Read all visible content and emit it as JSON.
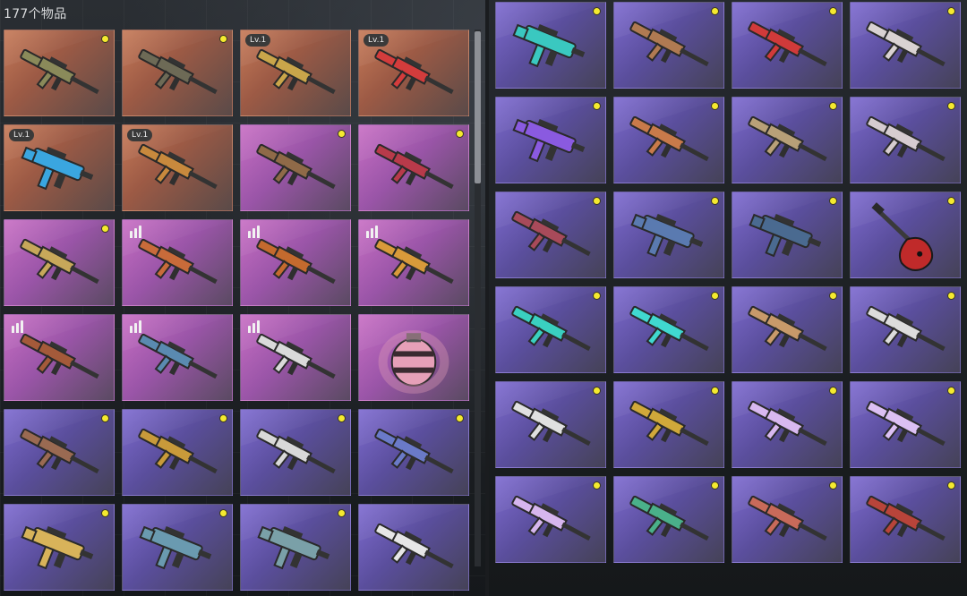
{
  "inventory": {
    "count_label": "177个物品"
  },
  "colors": {
    "orange": "#c67a58",
    "pink": "#c86fc4",
    "purple": "#7e6bd0",
    "dot": "#f5ea2f"
  },
  "left_items": [
    {
      "rarity": "orange",
      "badge": "dot",
      "icon": "assault-rifle-ak-icon",
      "weapon_color": "#8a8a5a"
    },
    {
      "rarity": "orange",
      "badge": "dot",
      "icon": "assault-rifle-ak-icon",
      "weapon_color": "#6d6a56"
    },
    {
      "rarity": "orange",
      "badge": "lv",
      "level": "Lv.1",
      "icon": "rifle-gold-icon",
      "weapon_color": "#c9a54a"
    },
    {
      "rarity": "orange",
      "badge": "lv",
      "level": "Lv.1",
      "icon": "rifle-red-icon",
      "weapon_color": "#d33c3c"
    },
    {
      "rarity": "orange",
      "badge": "lv",
      "level": "Lv.1",
      "icon": "smg-blue-icon",
      "weapon_color": "#3aa6e0"
    },
    {
      "rarity": "orange",
      "badge": "lv",
      "level": "Lv.1",
      "icon": "sniper-rifle-icon",
      "weapon_color": "#c8893d"
    },
    {
      "rarity": "pink",
      "badge": "dot",
      "icon": "sniper-rifle-icon",
      "weapon_color": "#8f6a48"
    },
    {
      "rarity": "pink",
      "badge": "dot",
      "icon": "assault-rifle-red-icon",
      "weapon_color": "#b83a4a"
    },
    {
      "rarity": "pink",
      "badge": "dot",
      "icon": "lmg-camo-icon",
      "weapon_color": "#c7a85a"
    },
    {
      "rarity": "pink",
      "badge": "bars",
      "icon": "assault-rifle-orange-icon",
      "weapon_color": "#c86b3a"
    },
    {
      "rarity": "pink",
      "badge": "bars",
      "icon": "assault-rifle-orange-icon",
      "weapon_color": "#c46a2e"
    },
    {
      "rarity": "pink",
      "badge": "bars",
      "icon": "assault-rifle-tiger-icon",
      "weapon_color": "#d89a3a"
    },
    {
      "rarity": "pink",
      "badge": "bars",
      "icon": "assault-rifle-wood-icon",
      "weapon_color": "#a45a3a"
    },
    {
      "rarity": "pink",
      "badge": "bars",
      "icon": "sniper-rifle-blue-icon",
      "weapon_color": "#5a8ab0"
    },
    {
      "rarity": "pink",
      "badge": "bars",
      "icon": "lmg-white-icon",
      "weapon_color": "#dadada"
    },
    {
      "rarity": "pink",
      "badge": "none",
      "icon": "grenade-icon",
      "weapon_color": "#e6a0b8"
    },
    {
      "rarity": "purple",
      "badge": "dot",
      "icon": "assault-rifle-ak-icon",
      "weapon_color": "#9a6a52"
    },
    {
      "rarity": "purple",
      "badge": "dot",
      "icon": "famas-gold-icon",
      "weapon_color": "#c89a3a"
    },
    {
      "rarity": "purple",
      "badge": "dot",
      "icon": "shotgun-silver-icon",
      "weapon_color": "#d9d9d9"
    },
    {
      "rarity": "purple",
      "badge": "dot",
      "icon": "assault-rifle-blue-icon",
      "weapon_color": "#6a7ac8"
    },
    {
      "rarity": "purple",
      "badge": "dot",
      "icon": "smg-gold-icon",
      "weapon_color": "#d8b35a"
    },
    {
      "rarity": "purple",
      "badge": "dot",
      "icon": "vector-camo-icon",
      "weapon_color": "#6a9ab0"
    },
    {
      "rarity": "purple",
      "badge": "dot",
      "icon": "vector-camo-icon",
      "weapon_color": "#7aa0a8"
    },
    {
      "rarity": "purple",
      "badge": "none",
      "icon": "assault-rifle-white-icon",
      "weapon_color": "#e6e6e6"
    }
  ],
  "right_items": [
    {
      "rarity": "purple",
      "badge": "dot",
      "icon": "vector-teal-icon",
      "weapon_color": "#3ac8c0"
    },
    {
      "rarity": "purple",
      "badge": "dot",
      "icon": "assault-rifle-wood-icon",
      "weapon_color": "#b07a52"
    },
    {
      "rarity": "purple",
      "badge": "dot",
      "icon": "sniper-rifle-red-icon",
      "weapon_color": "#d03a3a"
    },
    {
      "rarity": "purple",
      "badge": "dot",
      "icon": "assault-rifle-white-icon",
      "weapon_color": "#d9d2d2"
    },
    {
      "rarity": "purple",
      "badge": "dot",
      "icon": "smg-purple-icon",
      "weapon_color": "#8a5ae0"
    },
    {
      "rarity": "purple",
      "badge": "dot",
      "icon": "assault-rifle-ak-icon",
      "weapon_color": "#c87a4a"
    },
    {
      "rarity": "purple",
      "badge": "dot",
      "icon": "famas-camo-icon",
      "weapon_color": "#b8a078"
    },
    {
      "rarity": "purple",
      "badge": "dot",
      "icon": "assault-rifle-white-icon",
      "weapon_color": "#d6ccd0"
    },
    {
      "rarity": "purple",
      "badge": "dot",
      "icon": "assault-rifle-red-icon",
      "weapon_color": "#a84a5a"
    },
    {
      "rarity": "purple",
      "badge": "dot",
      "icon": "vector-camo-icon",
      "weapon_color": "#5a7ab0"
    },
    {
      "rarity": "purple",
      "badge": "dot",
      "icon": "vector-camo-icon",
      "weapon_color": "#4a6a90"
    },
    {
      "rarity": "purple",
      "badge": "dot",
      "icon": "guitar-icon",
      "weapon_color": "#c02a2a"
    },
    {
      "rarity": "purple",
      "badge": "dot",
      "icon": "assault-rifle-teal-icon",
      "weapon_color": "#3ad0c0"
    },
    {
      "rarity": "purple",
      "badge": "dot",
      "icon": "assault-rifle-teal-icon",
      "weapon_color": "#40d8d0"
    },
    {
      "rarity": "purple",
      "badge": "dot",
      "icon": "assault-rifle-orange-icon",
      "weapon_color": "#c89a6a"
    },
    {
      "rarity": "purple",
      "badge": "dot",
      "icon": "shotgun-silver-icon",
      "weapon_color": "#dcdcdc"
    },
    {
      "rarity": "purple",
      "badge": "dot",
      "icon": "lmg-white-icon",
      "weapon_color": "#e0e0e0"
    },
    {
      "rarity": "purple",
      "badge": "dot",
      "icon": "rifle-gold-icon",
      "weapon_color": "#d0a83a"
    },
    {
      "rarity": "purple",
      "badge": "dot",
      "icon": "shotgun-lavender-icon",
      "weapon_color": "#d8b8f0"
    },
    {
      "rarity": "purple",
      "badge": "dot",
      "icon": "shotgun-lavender-icon",
      "weapon_color": "#dcc0f4"
    },
    {
      "rarity": "purple",
      "badge": "dot",
      "icon": "shotgun-lavender-icon",
      "weapon_color": "#d6b6ee"
    },
    {
      "rarity": "purple",
      "badge": "dot",
      "icon": "lmg-green-icon",
      "weapon_color": "#4ab08a"
    },
    {
      "rarity": "purple",
      "badge": "dot",
      "icon": "assault-rifle-ak-icon",
      "weapon_color": "#c86a5a"
    },
    {
      "rarity": "purple",
      "badge": "dot",
      "icon": "assault-rifle-red-icon",
      "weapon_color": "#b8443a"
    }
  ]
}
